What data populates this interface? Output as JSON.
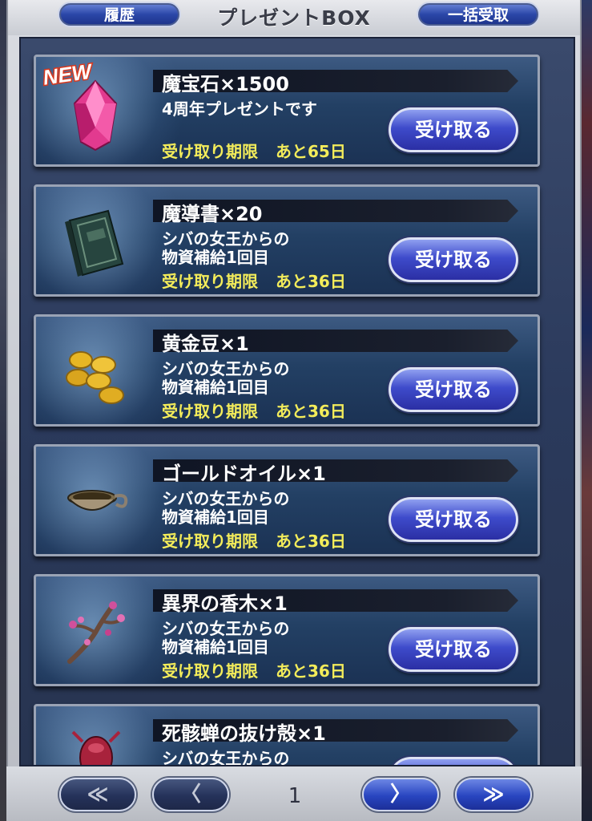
{
  "header": {
    "title": "プレゼントBOX",
    "history_label": "履歴",
    "receive_all_label": "一括受取"
  },
  "items": [
    {
      "new_badge": "NEW",
      "name": "魔宝石×1500",
      "desc": "4周年プレゼントです",
      "deadline_label": "受け取り期限",
      "remaining": "あと65日",
      "button": "受け取る",
      "icon": "magic-gem-icon"
    },
    {
      "name": "魔導書×20",
      "desc": "シバの女王からの\n物資補給1回目",
      "deadline_label": "受け取り期限",
      "remaining": "あと36日",
      "button": "受け取る",
      "icon": "grimoire-book-icon"
    },
    {
      "name": "黄金豆×1",
      "desc": "シバの女王からの\n物資補給1回目",
      "deadline_label": "受け取り期限",
      "remaining": "あと36日",
      "button": "受け取る",
      "icon": "golden-beans-icon"
    },
    {
      "name": "ゴールドオイル×1",
      "desc": "シバの女王からの\n物資補給1回目",
      "deadline_label": "受け取り期限",
      "remaining": "あと36日",
      "button": "受け取る",
      "icon": "oil-lamp-icon"
    },
    {
      "name": "異界の香木×1",
      "desc": "シバの女王からの\n物資補給1回目",
      "deadline_label": "受け取り期限",
      "remaining": "あと36日",
      "button": "受け取る",
      "icon": "incense-branch-icon"
    },
    {
      "name": "死骸蝉の抜け殻×1",
      "desc": "シバの女王からの",
      "icon": "cicada-shell-icon"
    }
  ],
  "pagination": {
    "first": "≪",
    "prev": "〈",
    "page": "1",
    "next": "〉",
    "last": "≫"
  },
  "colors": {
    "deadline": "#f3ec5a",
    "button_blue": "#3e4bcb",
    "panel": "#2b3a5c"
  }
}
